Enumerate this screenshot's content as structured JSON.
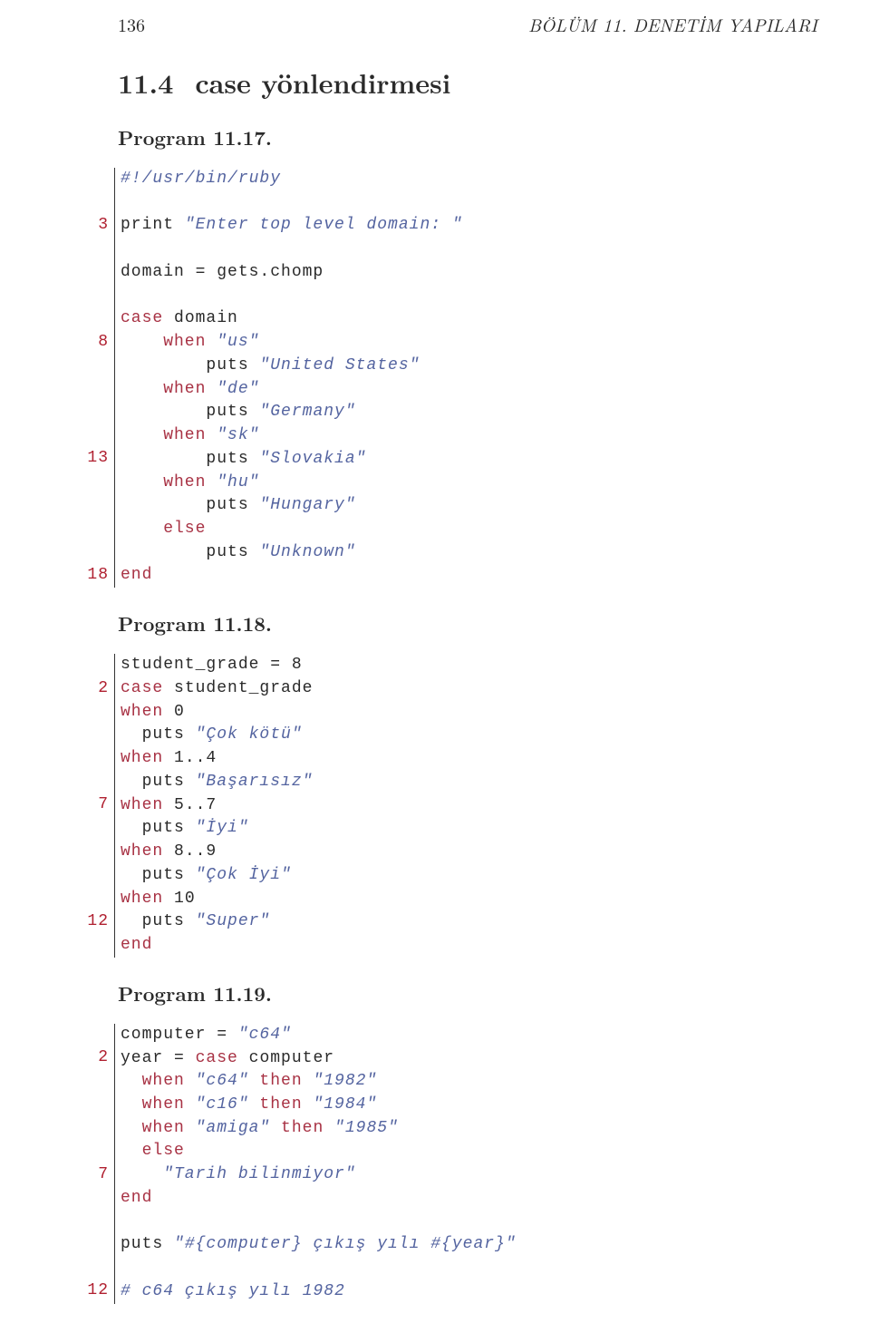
{
  "header": {
    "page_number": "136",
    "chapter": "BÖLÜM 11. DENETİM YAPILARI"
  },
  "section": {
    "number": "11.4",
    "title": "case yönlendirmesi"
  },
  "programs": [
    {
      "title": "Program 11.17."
    },
    {
      "title": "Program 11.18."
    },
    {
      "title": "Program 11.19."
    }
  ],
  "ln": {
    "p17_3": "3",
    "p17_8": "8",
    "p17_13": "13",
    "p17_18": "18",
    "p18_2": "2",
    "p18_7": "7",
    "p18_12": "12",
    "p19_2": "2",
    "p19_7": "7",
    "p19_12": "12"
  },
  "code17": {
    "l1": "#!/usr/bin/ruby",
    "l3a": "print ",
    "l3b": "\"Enter top level domain: \"",
    "l5": "domain = gets.chomp",
    "l7a": "case",
    "l7b": " domain",
    "l8a": "    when",
    "l8b": " \"us\"",
    "l9a": "        puts ",
    "l9b": "\"United States\"",
    "l10a": "    when",
    "l10b": " \"de\"",
    "l11a": "        puts ",
    "l11b": "\"Germany\"",
    "l12a": "    when",
    "l12b": " \"sk\"",
    "l13a": "        puts ",
    "l13b": "\"Slovakia\"",
    "l14a": "    when",
    "l14b": " \"hu\"",
    "l15a": "        puts ",
    "l15b": "\"Hungary\"",
    "l16": "    else",
    "l17a": "        puts ",
    "l17b": "\"Unknown\"",
    "l18": "end"
  },
  "code18": {
    "l1": "student_grade = 8",
    "l2a": "case",
    "l2b": " student_grade",
    "l3a": "when",
    "l3b": " 0",
    "l4a": "  puts ",
    "l4b": "\"Çok kötü\"",
    "l5a": "when",
    "l5b": " 1..4",
    "l6a": "  puts ",
    "l6b": "\"Başarısız\"",
    "l7a": "when",
    "l7b": " 5..7",
    "l8a": "  puts ",
    "l8b": "\"İyi\"",
    "l9a": "when",
    "l9b": " 8..9",
    "l10a": "  puts ",
    "l10b": "\"Çok İyi\"",
    "l11a": "when",
    "l11b": " 10",
    "l12a": "  puts ",
    "l12b": "\"Super\"",
    "l13": "end"
  },
  "code19": {
    "l1a": "computer = ",
    "l1b": "\"c64\"",
    "l2a": "year = ",
    "l2b": "case",
    "l2c": " computer",
    "l3a": "  when",
    "l3b": " \"c64\"",
    "l3c": " then",
    "l3d": " \"1982\"",
    "l4a": "  when",
    "l4b": " \"c16\"",
    "l4c": " then",
    "l4d": " \"1984\"",
    "l5a": "  when",
    "l5b": " \"amiga\"",
    "l5c": " then",
    "l5d": " \"1985\"",
    "l6": "  else",
    "l7": "    \"Tarih bilinmiyor\"",
    "l8": "end",
    "l10a": "puts ",
    "l10b": "\"#{computer} çıkış yılı #{year}\"",
    "l12": "# c64 çıkış yılı 1982"
  }
}
